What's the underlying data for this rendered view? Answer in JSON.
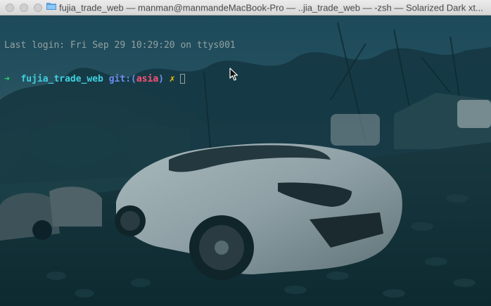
{
  "window": {
    "title": "fujia_trade_web — manman@manmandeMacBook-Pro — ..jia_trade_web — -zsh — Solarized Dark xt..."
  },
  "terminal": {
    "last_login": "Last login: Fri Sep 29 10:29:20 on ttys001",
    "prompt_arrow": "➜",
    "directory": "fujia_trade_web",
    "git_label": "git:",
    "paren_open": "(",
    "branch": "asia",
    "paren_close": ")",
    "dirty_marker": "✗"
  },
  "icons": {
    "folder": "folder-icon",
    "pointer": "mouse-pointer-icon"
  },
  "colors": {
    "background": "#0b2a33",
    "text": "#93a1a1",
    "arrow": "#2bd463",
    "directory": "#3fd0e0",
    "git": "#6d8cf0",
    "branch": "#ff4f78",
    "dirty": "#f1c40f"
  }
}
